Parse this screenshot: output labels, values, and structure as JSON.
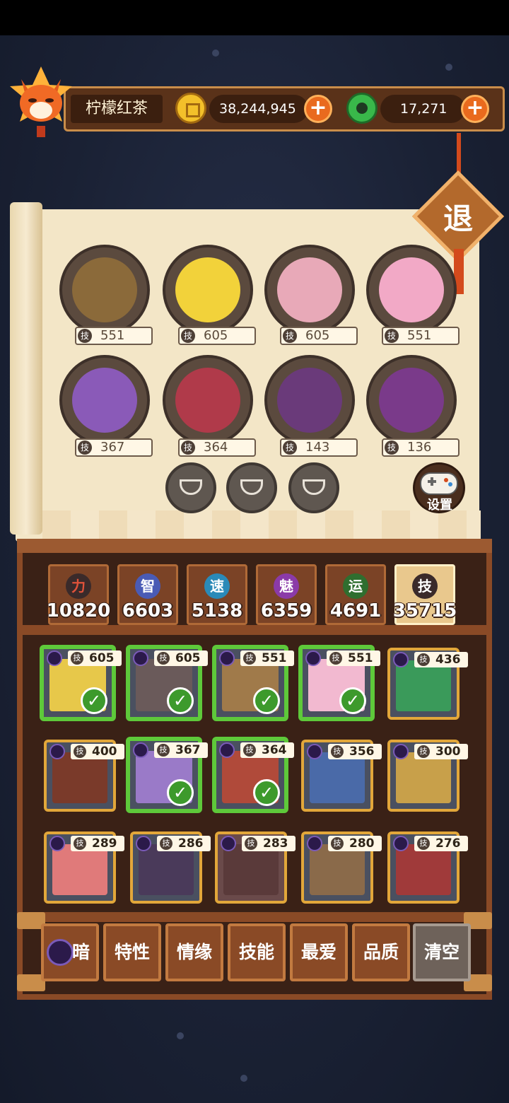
{
  "player": {
    "name": "柠檬红茶"
  },
  "currency": {
    "gold": "38,244,945",
    "jade": "17,271",
    "add_symbol": "+"
  },
  "exit_label": "退",
  "setting_label": "设置",
  "team": [
    {
      "value": "551"
    },
    {
      "value": "605"
    },
    {
      "value": "605"
    },
    {
      "value": "551"
    },
    {
      "value": "367"
    },
    {
      "value": "364"
    },
    {
      "value": "143"
    },
    {
      "value": "136"
    }
  ],
  "ji_char": "技",
  "stats": [
    {
      "label": "力",
      "value": "10820",
      "color": "#c0392b"
    },
    {
      "label": "智",
      "value": "6603",
      "color": "#4a5bb5"
    },
    {
      "label": "速",
      "value": "5138",
      "color": "#2a8ab8"
    },
    {
      "label": "魅",
      "value": "6359",
      "color": "#8b3aa8"
    },
    {
      "label": "运",
      "value": "4691",
      "color": "#3a8a3a"
    },
    {
      "label": "技",
      "value": "35715",
      "color": "#3a3a3a"
    }
  ],
  "cards": [
    {
      "value": "605"
    },
    {
      "value": "605"
    },
    {
      "value": "551"
    },
    {
      "value": "551"
    },
    {
      "value": "436"
    },
    {
      "value": "400"
    },
    {
      "value": "367"
    },
    {
      "value": "364"
    },
    {
      "value": "356"
    },
    {
      "value": "300"
    },
    {
      "value": "289"
    },
    {
      "value": "286"
    },
    {
      "value": "283"
    },
    {
      "value": "280"
    },
    {
      "value": "276"
    }
  ],
  "checkmark": "✓",
  "filters": [
    {
      "label": "暗"
    },
    {
      "label": "特性"
    },
    {
      "label": "情缘"
    },
    {
      "label": "技能"
    },
    {
      "label": "最爱"
    },
    {
      "label": "品质"
    },
    {
      "label": "清空"
    }
  ]
}
